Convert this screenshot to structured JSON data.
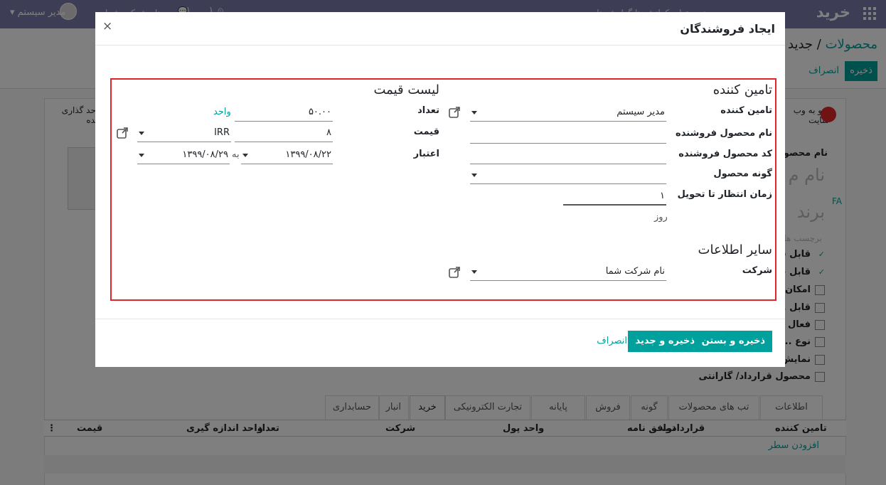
{
  "topbar": {
    "app_title": "خرید",
    "user_name": "مدیر سیستم",
    "company_ghost": "نام شرکت شما",
    "badge_msgs": "۱",
    "badge_act": "۱",
    "menu_ghost": "ینسه تولی کرانش ها گزارش ها",
    "icons": [
      "apps-grid-icon",
      "user-avatar",
      "clock-icon",
      "chat-icon"
    ]
  },
  "background": {
    "breadcrumb_root": "محصولات",
    "breadcrumb_sep": "/",
    "breadcrumb_current": "جدید",
    "save_label": "ذخیره",
    "discard_label": "انصراف",
    "smart_button_1": "برو به وب سایت",
    "smart_button_2": "واحد گذاری شده",
    "product_name_label": "نام محصول",
    "product_name_placeholder": "نام م",
    "brand_placeholder": "برند",
    "lang_code": "FA",
    "tags_placeholder": "برچسب ها",
    "checkbox_labels": [
      "قابل فروش",
      "قابل خرید",
      "امکان ...",
      "قابل ...",
      "فعال ...",
      "نوع ...",
      "نمایش ...",
      "محصول قرارداد/ گارانتی"
    ],
    "checkbox_states": [
      true,
      true,
      false,
      false,
      false,
      false,
      false,
      false
    ],
    "tabs": [
      "اطلاعات عمومی",
      "تب های محصولات",
      "گونه",
      "فروش",
      "پایانه فروش",
      "تجارت الکترونیکی",
      "خرید",
      "انبار",
      "حسابداری"
    ],
    "active_tab": "خرید",
    "table_headers": [
      "تامین کننده",
      "قرارداد...",
      "توافق نامه",
      "واحد پول",
      "شرکت",
      "تعداد",
      "واحد اندازه گیری",
      "قیمت"
    ],
    "add_line": "افزودن سطر"
  },
  "modal": {
    "title": "ایجاد فروشندگان",
    "close_glyph": "×",
    "vendor_section": {
      "title": "تامین کننده",
      "vendor_label": "تامین کننده",
      "vendor_value": "مدیر سیستم",
      "vendor_product_name_label": "نام محصول فروشنده",
      "vendor_product_code_label": "کد محصول فروشنده",
      "variant_label": "گونه محصول",
      "lead_time_label": "زمان انتظار تا تحویل",
      "lead_time_value": "۱",
      "lead_time_unit": "روز"
    },
    "pricelist_section": {
      "title": "لیست قیمت",
      "qty_label": "تعداد",
      "qty_value": "۵۰.۰۰",
      "qty_unit": "واحد",
      "price_label": "قیمت",
      "price_value": "۸",
      "currency": "IRR",
      "validity_label": "اعتبار",
      "date_from": "۱۳۹۹/۰۸/۲۲",
      "to_label": "به",
      "date_to": "۱۳۹۹/۰۸/۲۹"
    },
    "other_section": {
      "title": "سایر اطلاعات",
      "company_label": "شرکت",
      "company_value": "نام شرکت شما"
    },
    "footer": {
      "save_close": "ذخیره و بستن",
      "save_new": "ذخیره و جدید",
      "discard": "انصراف"
    },
    "highlight_color": "#e0262b"
  },
  "colors": {
    "brand": "#7c7bad",
    "accent": "#00a09d"
  }
}
